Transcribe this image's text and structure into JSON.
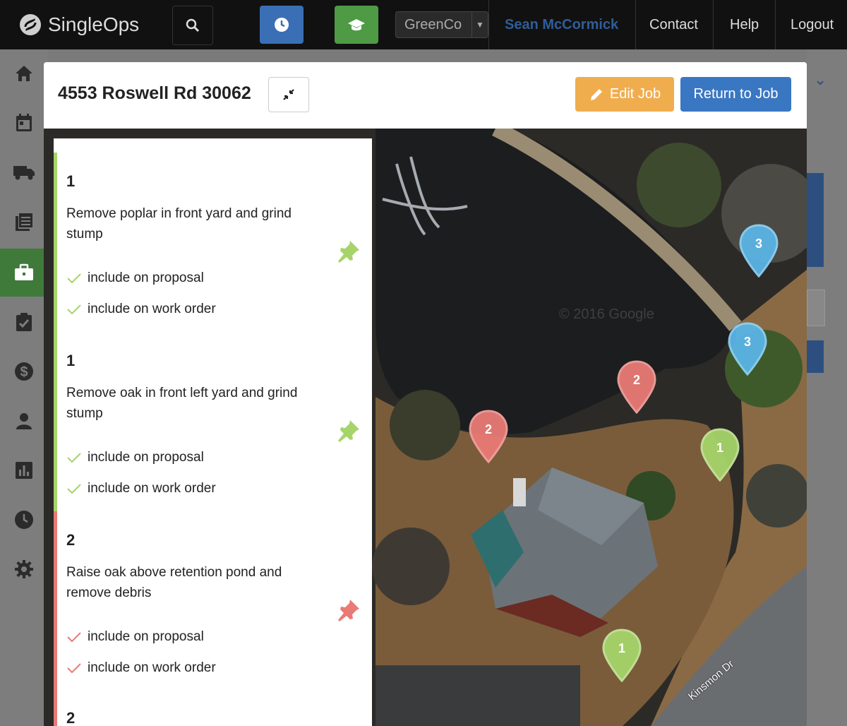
{
  "header": {
    "brand": "SingleOps",
    "company": "GreenCo",
    "user": "Sean McCormick",
    "contact": "Contact",
    "help": "Help",
    "logout": "Logout"
  },
  "colors": {
    "green": "#a6d46a",
    "red": "#e97a76",
    "blue": "#5ab4e5",
    "edit": "#f0ad4e",
    "return": "#3a77c2"
  },
  "sidebar": {
    "icons": [
      "home-icon",
      "calendar-icon",
      "truck-icon",
      "list-icon",
      "briefcase-icon",
      "clipboard-icon",
      "dollar-icon",
      "person-icon",
      "chart-icon",
      "clock-icon",
      "gear-icon"
    ]
  },
  "modal": {
    "title": "4553 Roswell Rd 30062",
    "edit_label": "Edit Job",
    "return_label": "Return to Job"
  },
  "map": {
    "watermark": "© 2016 Google",
    "road": "Kinsmon Dr"
  },
  "work_items": [
    {
      "number": "1",
      "description": "Remove poplar in front yard and grind stump",
      "check1": "include on proposal",
      "check2": "include on work order",
      "color": "#a6d46a"
    },
    {
      "number": "1",
      "description": "Remove oak in front left yard and grind stump",
      "check1": "include on proposal",
      "check2": "include on work order",
      "color": "#a6d46a"
    },
    {
      "number": "2",
      "description": "Raise oak above retention pond and remove debris",
      "check1": "include on proposal",
      "check2": "include on work order",
      "color": "#e97a76"
    },
    {
      "number": "2",
      "description": "",
      "check1": "",
      "check2": "",
      "color": "#e97a76"
    }
  ],
  "pins": [
    {
      "label": "3",
      "color": "#5ab4e5"
    },
    {
      "label": "3",
      "color": "#5ab4e5"
    },
    {
      "label": "2",
      "color": "#e97a76"
    },
    {
      "label": "2",
      "color": "#e97a76"
    },
    {
      "label": "1",
      "color": "#a6d46a"
    },
    {
      "label": "1",
      "color": "#a6d46a"
    }
  ]
}
